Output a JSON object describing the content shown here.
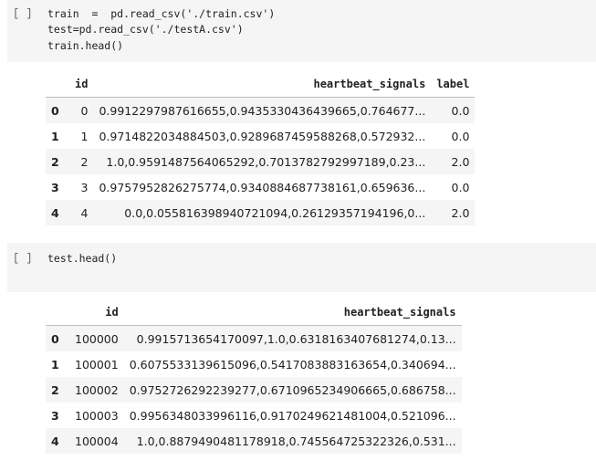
{
  "cell1": {
    "prompt": "[ ]",
    "code_lines": [
      "train  =  pd.read_csv('./train.csv')",
      "test=pd.read_csv('./testA.csv')",
      "train.head()"
    ],
    "table": {
      "columns": [
        "",
        "id",
        "heartbeat_signals",
        "label"
      ],
      "rows": [
        {
          "index": "0",
          "id": "0",
          "signals": "0.9912297987616655,0.9435330436439665,0.764677...",
          "label": "0.0"
        },
        {
          "index": "1",
          "id": "1",
          "signals": "0.9714822034884503,0.9289687459588268,0.572932...",
          "label": "0.0"
        },
        {
          "index": "2",
          "id": "2",
          "signals": "1.0,0.9591487564065292,0.7013782792997189,0.23...",
          "label": "2.0"
        },
        {
          "index": "3",
          "id": "3",
          "signals": "0.9757952826275774,0.9340884687738161,0.659636...",
          "label": "0.0"
        },
        {
          "index": "4",
          "id": "4",
          "signals": "0.0,0.055816398940721094,0.26129357194196,0...",
          "label": "2.0"
        }
      ]
    }
  },
  "cell2": {
    "prompt": "[ ]",
    "code_lines": [
      "test.head()"
    ],
    "table": {
      "columns": [
        "",
        "id",
        "heartbeat_signals"
      ],
      "rows": [
        {
          "index": "0",
          "id": "100000",
          "signals": "0.9915713654170097,1.0,0.6318163407681274,0.13..."
        },
        {
          "index": "1",
          "id": "100001",
          "signals": "0.6075533139615096,0.5417083883163654,0.340694..."
        },
        {
          "index": "2",
          "id": "100002",
          "signals": "0.9752726292239277,0.6710965234906665,0.686758..."
        },
        {
          "index": "3",
          "id": "100003",
          "signals": "0.9956348033996116,0.9170249621481004,0.521096..."
        },
        {
          "index": "4",
          "id": "100004",
          "signals": "1.0,0.8879490481178918,0.745564725322326,0.531..."
        }
      ]
    }
  }
}
